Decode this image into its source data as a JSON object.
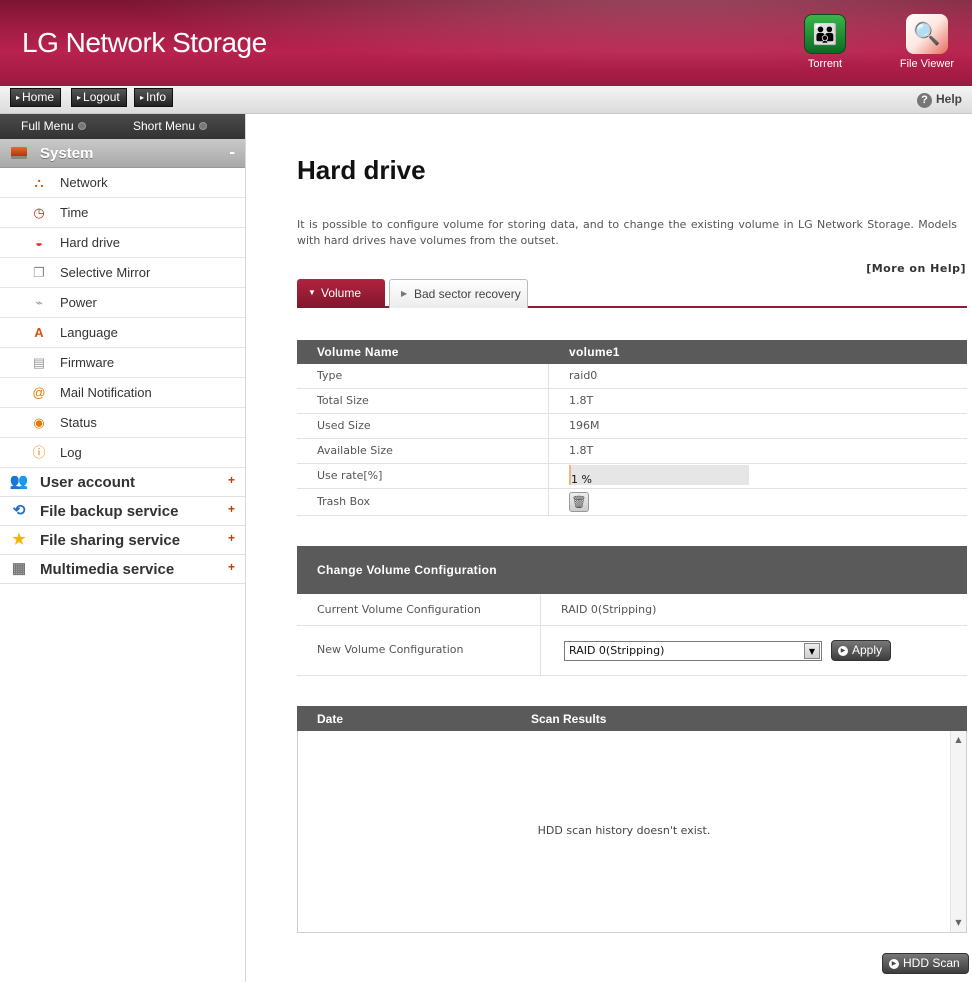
{
  "app": {
    "brand": "LG Network Storage",
    "header_buttons": [
      {
        "label": "Torrent",
        "icon": "torrent-icon"
      },
      {
        "label": "File Viewer",
        "icon": "file-viewer-icon"
      }
    ]
  },
  "topbar": {
    "nav": [
      "Home",
      "Logout",
      "Info"
    ],
    "help": "Help"
  },
  "sidebar": {
    "menu_tabs": [
      "Full Menu",
      "Short Menu"
    ],
    "system": {
      "label": "System",
      "collapse": "-",
      "items": [
        {
          "label": "Network",
          "icon": "network-icon"
        },
        {
          "label": "Time",
          "icon": "clock-icon"
        },
        {
          "label": "Hard drive",
          "icon": "hard-drive-icon"
        },
        {
          "label": "Selective Mirror",
          "icon": "mirror-icon"
        },
        {
          "label": "Power",
          "icon": "power-icon"
        },
        {
          "label": "Language",
          "icon": "language-icon"
        },
        {
          "label": "Firmware",
          "icon": "firmware-icon"
        },
        {
          "label": "Mail Notification",
          "icon": "mail-icon"
        },
        {
          "label": "Status",
          "icon": "status-icon"
        },
        {
          "label": "Log",
          "icon": "log-icon"
        }
      ]
    },
    "categories": [
      {
        "label": "User account",
        "icon": "user-icon",
        "expand": "+"
      },
      {
        "label": "File backup service",
        "icon": "backup-icon",
        "expand": "+"
      },
      {
        "label": "File sharing service",
        "icon": "star-icon",
        "expand": "+"
      },
      {
        "label": "Multimedia service",
        "icon": "multimedia-icon",
        "expand": "+"
      }
    ]
  },
  "main": {
    "title": "Hard drive",
    "description": "It is possible to configure volume for storing data, and to change the existing volume in LG Network Storage. Models with hard drives have volumes from the outset.",
    "more_help": "[More on Help]",
    "tabs": [
      {
        "label": "Volume",
        "active": true
      },
      {
        "label": "Bad sector recovery",
        "active": false
      }
    ],
    "volume": {
      "header": {
        "name_label": "Volume Name",
        "name_value": "volume1"
      },
      "rows": [
        {
          "label": "Type",
          "value": "raid0"
        },
        {
          "label": "Total Size",
          "value": "1.8T"
        },
        {
          "label": "Used Size",
          "value": "196M"
        },
        {
          "label": "Available Size",
          "value": "1.8T"
        }
      ],
      "use_rate_label": "Use rate[%]",
      "use_rate_text": "1 %",
      "use_rate_value": 1,
      "trash_label": "Trash Box"
    },
    "change_config": {
      "title": "Change Volume Configuration",
      "current_label": "Current Volume Configuration",
      "current_value": "RAID 0(Stripping)",
      "new_label": "New Volume Configuration",
      "new_selected": "RAID 0(Stripping)",
      "apply": "Apply"
    },
    "scan": {
      "col_date": "Date",
      "col_results": "Scan Results",
      "empty": "HDD scan history doesn't exist.",
      "button": "HDD Scan"
    }
  },
  "colors": {
    "brand_red": "#a31d44",
    "table_header": "#5a5a5a",
    "progress_fill": "#f4b183"
  }
}
